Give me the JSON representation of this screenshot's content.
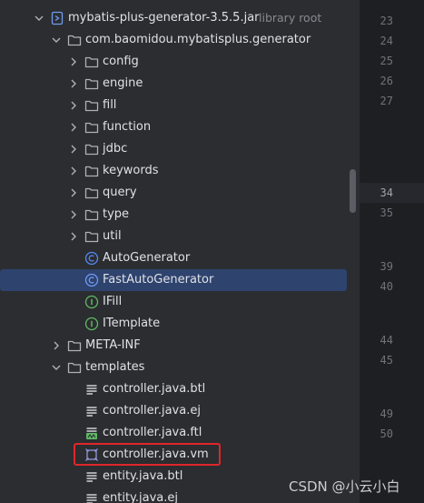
{
  "tree": {
    "jar": {
      "label": "mybatis-plus-generator-3.5.5.jar",
      "suffix": "library root"
    },
    "package": {
      "label": "com.baomidou.mybatisplus.generator"
    },
    "folders": [
      {
        "label": "config"
      },
      {
        "label": "engine"
      },
      {
        "label": "fill"
      },
      {
        "label": "function"
      },
      {
        "label": "jdbc"
      },
      {
        "label": "keywords"
      },
      {
        "label": "query"
      },
      {
        "label": "type"
      },
      {
        "label": "util"
      }
    ],
    "classes": [
      {
        "label": "AutoGenerator",
        "kind": "class-icon"
      },
      {
        "label": "FastAutoGenerator",
        "kind": "class-icon",
        "selected": true
      },
      {
        "label": "IFill",
        "kind": "interface-icon"
      },
      {
        "label": "ITemplate",
        "kind": "interface-icon"
      }
    ],
    "meta_inf": {
      "label": "META-INF"
    },
    "templates": {
      "label": "templates"
    },
    "template_files": [
      {
        "label": "controller.java.btl",
        "kind": "text-file-icon"
      },
      {
        "label": "controller.java.ej",
        "kind": "text-file-icon"
      },
      {
        "label": "controller.java.ftl",
        "kind": "freemarker-file-icon"
      },
      {
        "label": "controller.java.vm",
        "kind": "velocity-file-icon",
        "highlighted": true
      },
      {
        "label": "entity.java.btl",
        "kind": "text-file-icon"
      },
      {
        "label": "entity.java.ej",
        "kind": "text-file-icon"
      }
    ]
  },
  "editor": {
    "line_numbers": [
      "23",
      "24",
      "25",
      "26",
      "27",
      "34",
      "35",
      "39",
      "40",
      "44",
      "45",
      "49",
      "50"
    ],
    "current_line": "34"
  },
  "colors": {
    "panel": "#2b2d30",
    "editor": "#1e1f22",
    "selection": "#2e436e",
    "highlight_border": "#e0262a",
    "class_icon": "#548af7",
    "interface_icon": "#5fb865"
  },
  "watermark": "CSDN @小云小白"
}
